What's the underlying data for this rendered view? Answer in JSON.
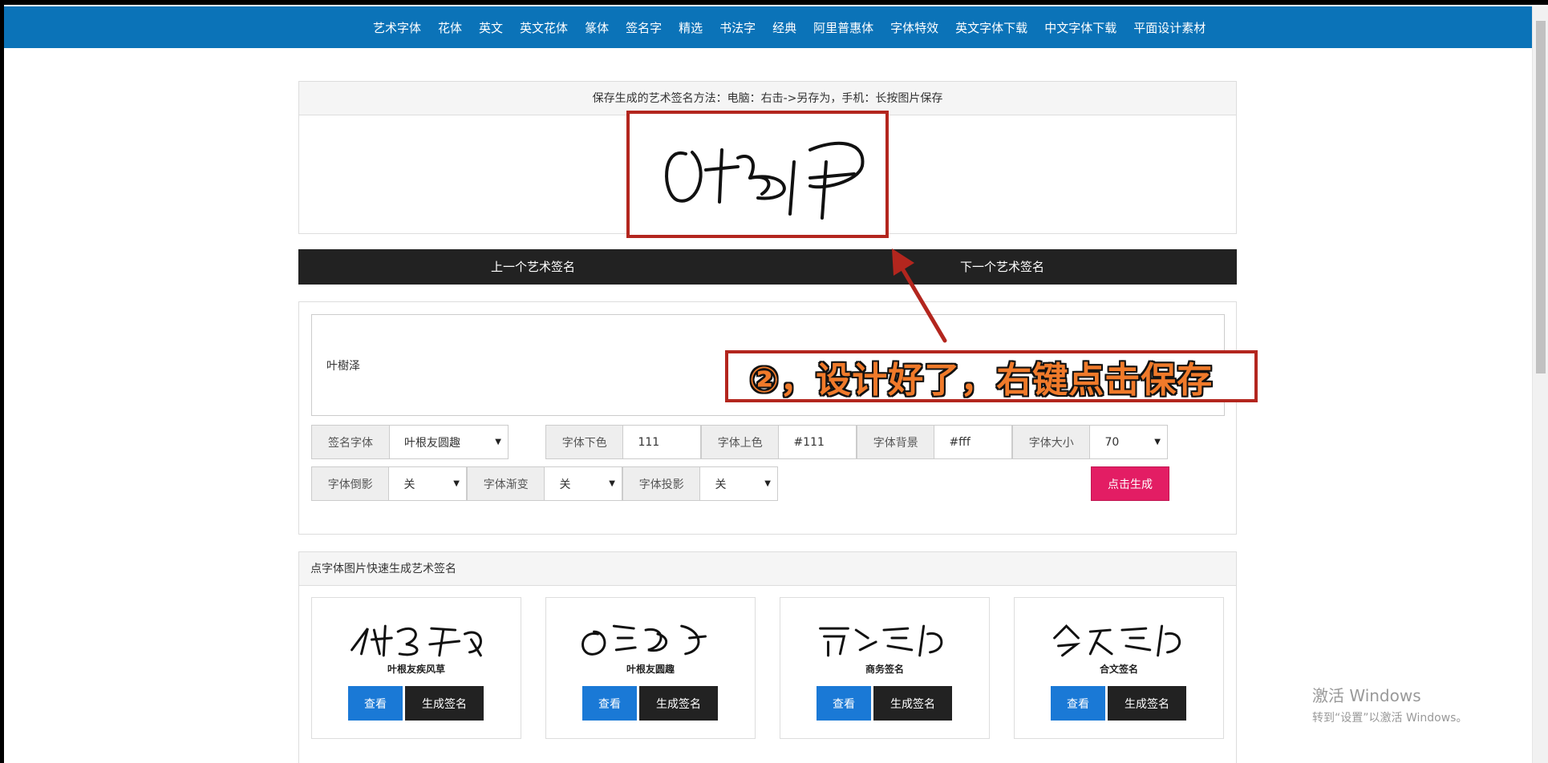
{
  "topnav": {
    "items": [
      "艺术字体",
      "花体",
      "英文",
      "英文花体",
      "篆体",
      "签名字",
      "精选",
      "书法字",
      "经典",
      "阿里普惠体",
      "字体特效",
      "英文字体下载",
      "中文字体下载",
      "平面设计素材"
    ]
  },
  "result_panel": {
    "hint": "保存生成的艺术签名方法：电脑：右击->另存为，手机：长按图片保存"
  },
  "pager": {
    "prev_label": "上一个艺术签名",
    "next_label": "下一个艺术签名"
  },
  "form": {
    "name_value": "叶樹泽",
    "controls": {
      "font": {
        "label": "签名字体",
        "value": "叶根友圆趣"
      },
      "bottom_color": {
        "label": "字体下色",
        "value": "111"
      },
      "top_color": {
        "label": "字体上色",
        "value": "#111"
      },
      "background": {
        "label": "字体背景",
        "value": "#fff"
      },
      "size": {
        "label": "字体大小",
        "value": "70"
      },
      "reflection": {
        "label": "字体倒影",
        "value": "关"
      },
      "gradient": {
        "label": "字体渐变",
        "value": "关"
      },
      "shadow": {
        "label": "字体投影",
        "value": "关"
      }
    },
    "generate_label": "点击生成"
  },
  "quick_panel": {
    "title": "点字体图片快速生成艺术签名",
    "cards": [
      {
        "name": "叶根友疾风草",
        "view_label": "查看",
        "gen_label": "生成签名"
      },
      {
        "name": "叶根友圆趣",
        "view_label": "查看",
        "gen_label": "生成签名"
      },
      {
        "name": "商务签名",
        "view_label": "查看",
        "gen_label": "生成签名"
      },
      {
        "name": "合文签名",
        "view_label": "查看",
        "gen_label": "生成签名"
      }
    ]
  },
  "callout": {
    "text": "②，设计好了，右键点击保存"
  },
  "watermark": {
    "line1": "激活 Windows",
    "line2": "转到“设置”以激活 Windows。"
  },
  "colors": {
    "nav_blue": "#0b73b8",
    "generate_pink": "#e31d64",
    "view_blue": "#1a79d6",
    "callout_red": "#b3261e",
    "callout_orange": "#f07a2a"
  }
}
